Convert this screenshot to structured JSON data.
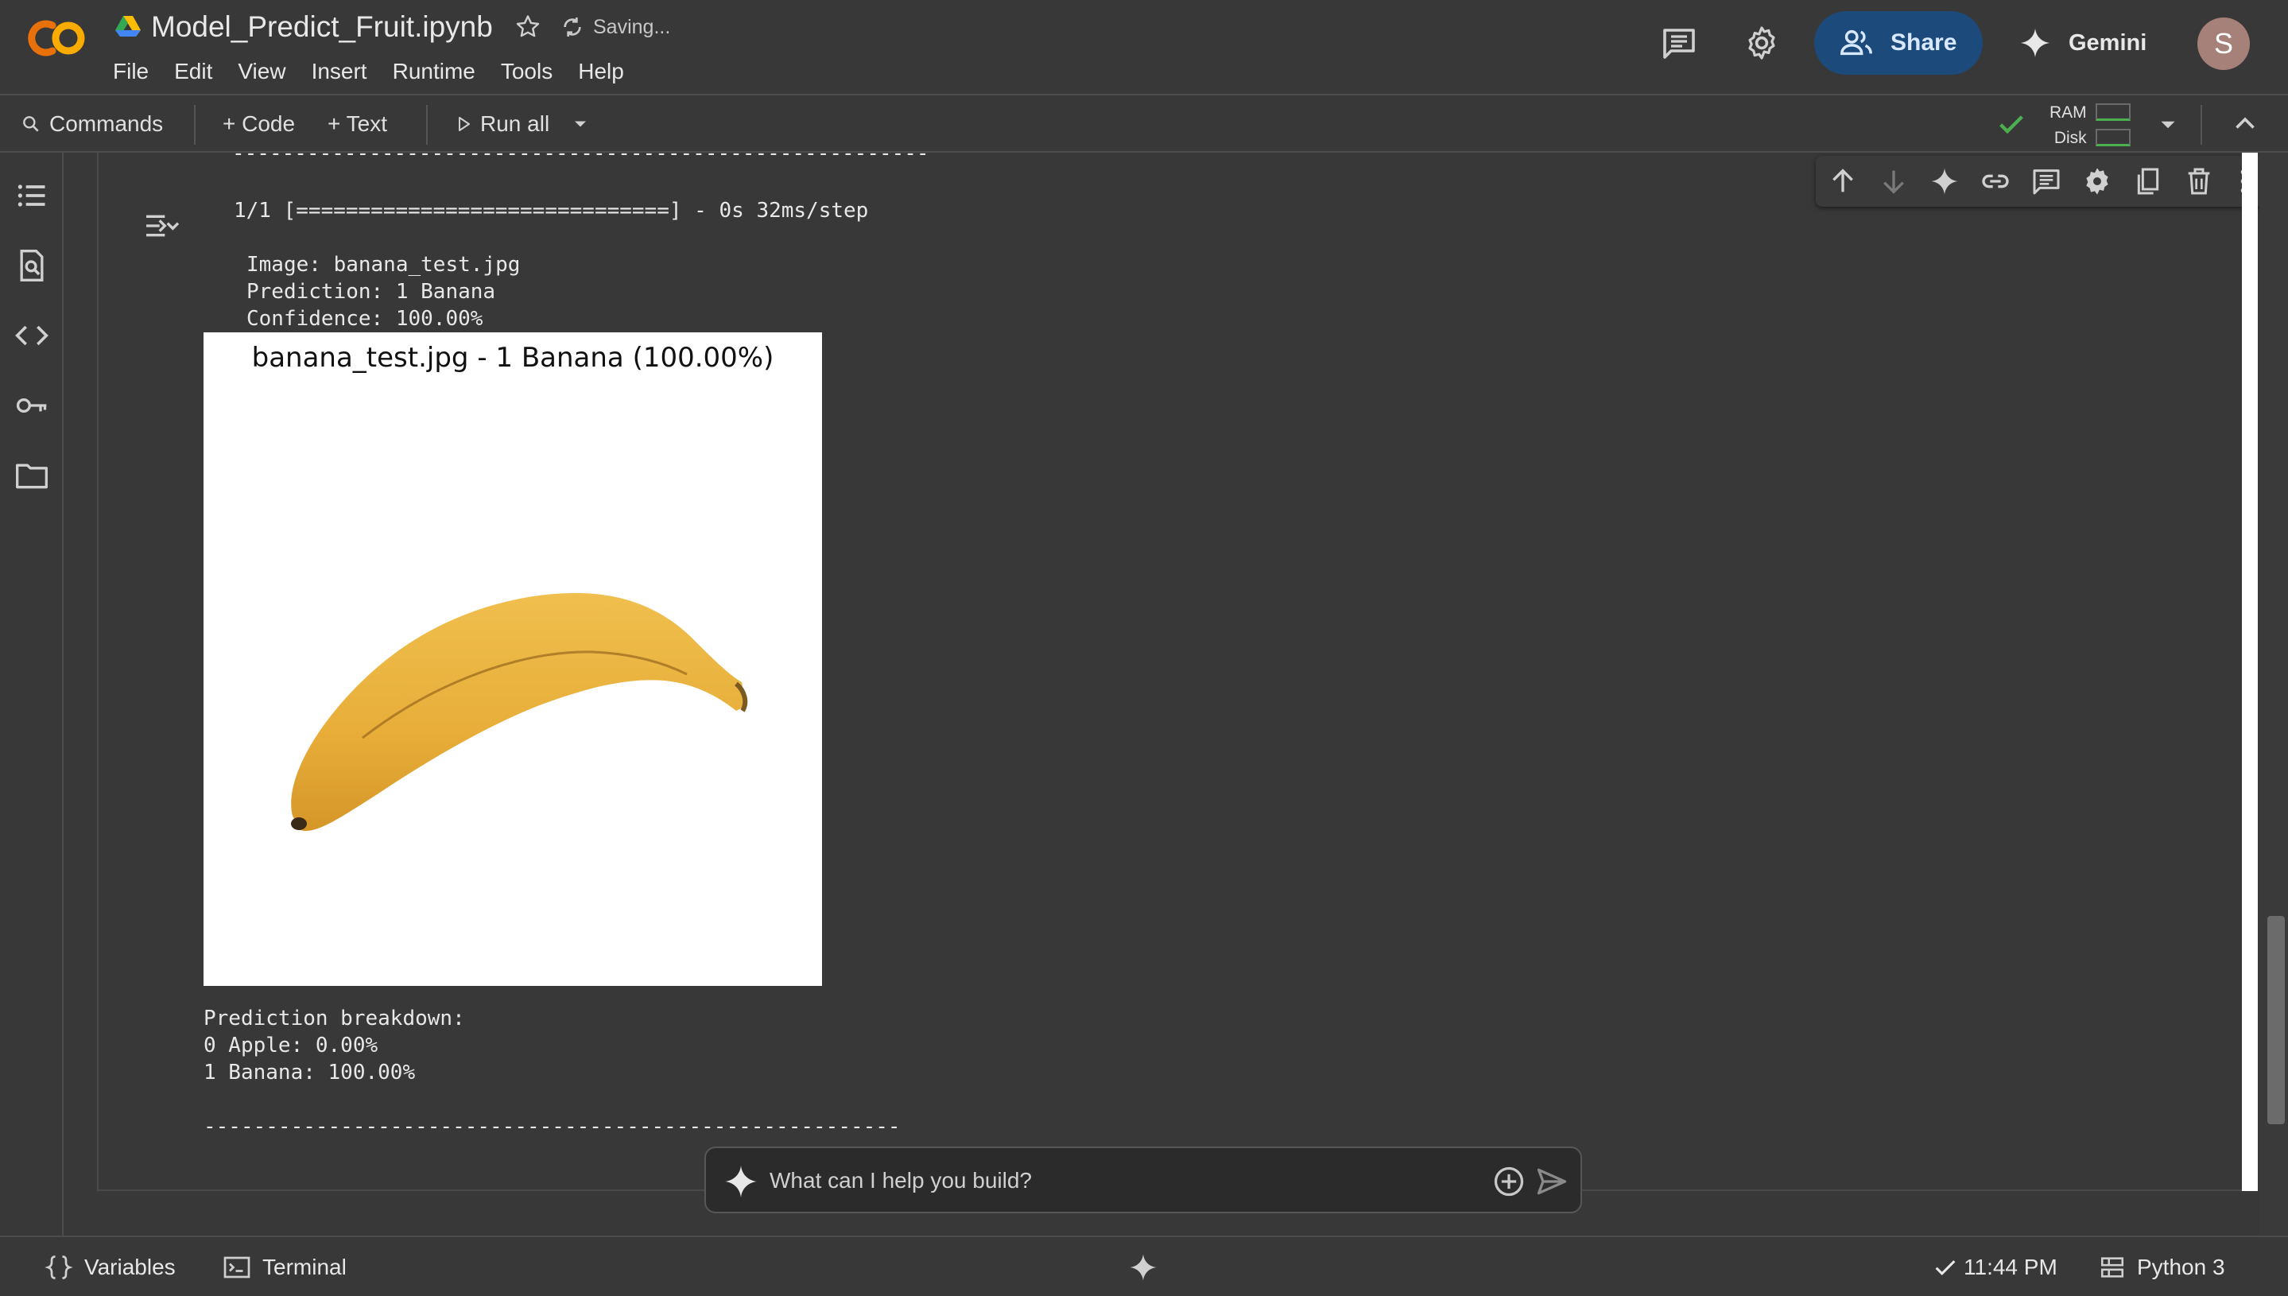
{
  "header": {
    "title": "Model_Predict_Fruit.ipynb",
    "status": "Saving...",
    "menu": [
      "File",
      "Edit",
      "View",
      "Insert",
      "Runtime",
      "Tools",
      "Help"
    ],
    "share_label": "Share",
    "gemini_label": "Gemini",
    "avatar_letter": "S"
  },
  "toolbar": {
    "commands_label": "Commands",
    "code_label": "+ Code",
    "text_label": "+ Text",
    "run_all_label": "Run all",
    "ram_label": "RAM",
    "disk_label": "Disk"
  },
  "cell": {
    "separator_top": "--------------------------------------------------------",
    "progress_line": "1/1 [==============================] - 0s 32ms/step",
    "image_line": "Image: banana_test.jpg",
    "prediction_line": "Prediction: 1 Banana",
    "confidence_line": "Confidence: 100.00%",
    "figure_title": "banana_test.jpg - 1 Banana (100.00%)",
    "breakdown_header": "Prediction breakdown:",
    "breakdown_items": [
      "0 Apple: 0.00%",
      "1 Banana: 100.00%"
    ],
    "separator_bottom": "--------------------------------------------------------"
  },
  "prompt": {
    "placeholder": "What can I help you build?"
  },
  "statusbar": {
    "variables_label": "Variables",
    "terminal_label": "Terminal",
    "time_label": "11:44 PM",
    "kernel_label": "Python 3"
  },
  "colors": {
    "background": "#383838",
    "share_bg": "#1c4a7a",
    "logo_orange": "#f9ab00",
    "logo_dark_orange": "#e8710a",
    "check_green": "#4caf50",
    "banana_yellow": "#e8b23c"
  }
}
